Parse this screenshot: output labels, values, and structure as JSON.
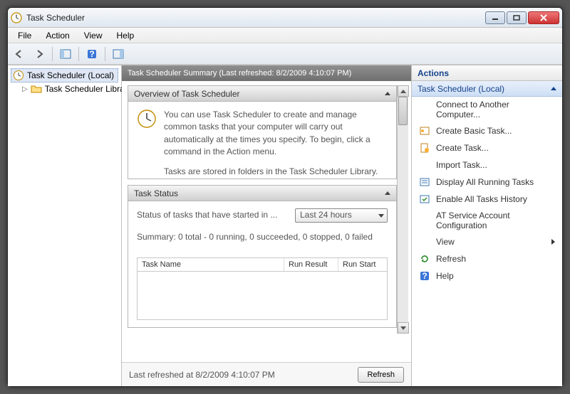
{
  "window": {
    "title": "Task Scheduler"
  },
  "menu": {
    "file": "File",
    "action": "Action",
    "view": "View",
    "help": "Help"
  },
  "tree": {
    "root": "Task Scheduler (Local)",
    "child": "Task Scheduler Library"
  },
  "summary": {
    "header": "Task Scheduler Summary (Last refreshed: 8/2/2009 4:10:07 PM)"
  },
  "overview": {
    "title": "Overview of Task Scheduler",
    "p1": "You can use Task Scheduler to create and manage common tasks that your computer will carry out automatically at the times you specify. To begin, click a command in the Action menu.",
    "p2": "Tasks are stored in folders in the Task Scheduler Library. To view or perform an operation on an"
  },
  "status": {
    "title": "Task Status",
    "started_in_label": "Status of tasks that have started in ...",
    "period": "Last 24 hours",
    "summary": "Summary: 0 total - 0 running, 0 succeeded, 0 stopped, 0 failed",
    "col1": "Task Name",
    "col2": "Run Result",
    "col3": "Run Start"
  },
  "footer": {
    "last_refreshed": "Last refreshed at 8/2/2009 4:10:07 PM",
    "refresh": "Refresh"
  },
  "actions": {
    "header": "Actions",
    "group": "Task Scheduler (Local)",
    "items": [
      "Connect to Another Computer...",
      "Create Basic Task...",
      "Create Task...",
      "Import Task...",
      "Display All Running Tasks",
      "Enable All Tasks History",
      "AT Service Account Configuration",
      "View",
      "Refresh",
      "Help"
    ]
  }
}
